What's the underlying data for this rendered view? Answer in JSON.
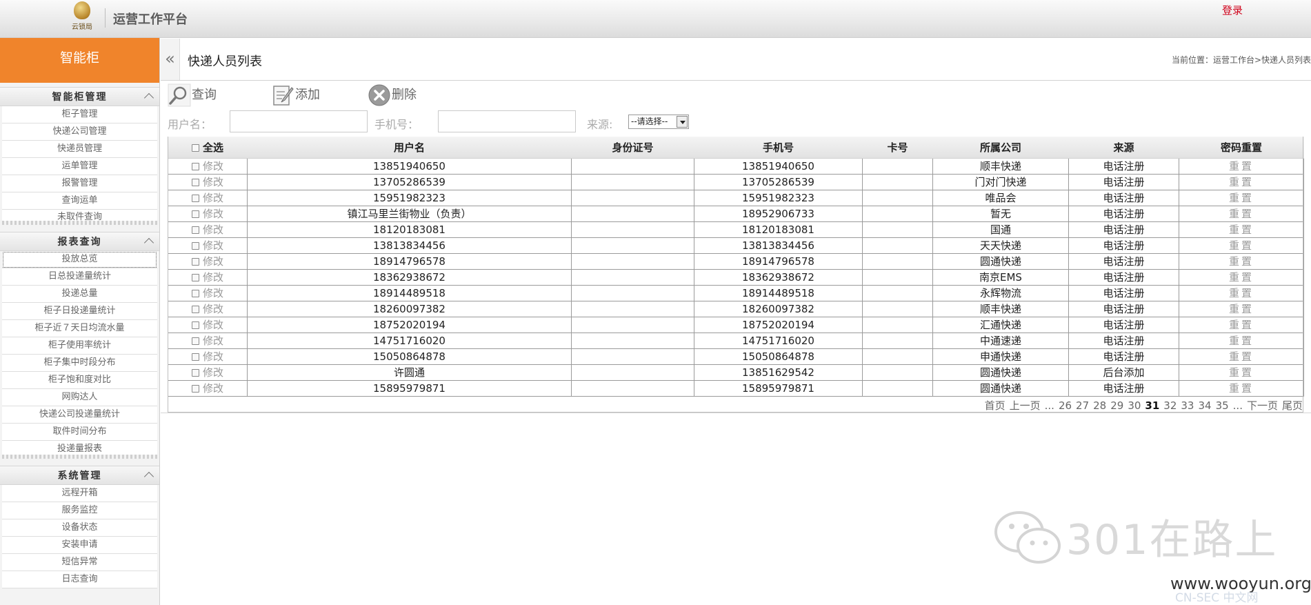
{
  "header": {
    "logo_text": "云锁局",
    "title": "运营工作平台",
    "login": "登录"
  },
  "sidebar": {
    "brand": "智能柜",
    "groups": [
      {
        "title": "智能柜管理",
        "items": [
          "柜子管理",
          "快递公司管理",
          "快递员管理",
          "运单管理",
          "报警管理",
          "查询运单",
          "未取件查询"
        ]
      },
      {
        "title": "报表查询",
        "items": [
          "投放总览",
          "日总投递量统计",
          "投递总量",
          "柜子日投递量统计",
          "柜子近７天日均流水量",
          "柜子使用率统计",
          "柜子集中时段分布",
          "柜子饱和度对比",
          "网购达人",
          "快递公司投递量统计",
          "取件时间分布",
          "投递量报表"
        ]
      },
      {
        "title": "系统管理",
        "items": [
          "远程开箱",
          "服务监控",
          "设备状态",
          "安装申请",
          "短信异常",
          "日志查询"
        ]
      }
    ]
  },
  "main": {
    "title": "快递人员列表",
    "breadcrumb": "当前位置：运营工作台>快递人员列表",
    "toolbar": {
      "query": "查询",
      "add": "添加",
      "delete": "删除"
    },
    "search": {
      "username_label": "用户名：",
      "phone_label": "手机号：",
      "source_label": "来源:",
      "source_selected": "--请选择--"
    },
    "columns": {
      "select_all": "全选",
      "username": "用户名",
      "id_no": "身份证号",
      "phone": "手机号",
      "card": "卡号",
      "company": "所属公司",
      "source": "来源",
      "reset": "密码重置"
    },
    "edit_label": "修改",
    "reset_label": "重置",
    "rows": [
      {
        "username": "13851940650",
        "id_no": "",
        "phone": "13851940650",
        "card": "",
        "company": "顺丰快递",
        "source": "电话注册"
      },
      {
        "username": "13705286539",
        "id_no": "",
        "phone": "13705286539",
        "card": "",
        "company": "门对门快递",
        "source": "电话注册"
      },
      {
        "username": "15951982323",
        "id_no": "",
        "phone": "15951982323",
        "card": "",
        "company": "唯品会",
        "source": "电话注册"
      },
      {
        "username": "镇江马里兰街物业（负责）",
        "id_no": "",
        "phone": "18952906733",
        "card": "",
        "company": "暂无",
        "source": "电话注册"
      },
      {
        "username": "18120183081",
        "id_no": "",
        "phone": "18120183081",
        "card": "",
        "company": "国通",
        "source": "电话注册"
      },
      {
        "username": "13813834456",
        "id_no": "",
        "phone": "13813834456",
        "card": "",
        "company": "天天快递",
        "source": "电话注册"
      },
      {
        "username": "18914796578",
        "id_no": "",
        "phone": "18914796578",
        "card": "",
        "company": "圆通快递",
        "source": "电话注册"
      },
      {
        "username": "18362938672",
        "id_no": "",
        "phone": "18362938672",
        "card": "",
        "company": "南京EMS",
        "source": "电话注册"
      },
      {
        "username": "18914489518",
        "id_no": "",
        "phone": "18914489518",
        "card": "",
        "company": "永辉物流",
        "source": "电话注册"
      },
      {
        "username": "18260097382",
        "id_no": "",
        "phone": "18260097382",
        "card": "",
        "company": "顺丰快递",
        "source": "电话注册"
      },
      {
        "username": "18752020194",
        "id_no": "",
        "phone": "18752020194",
        "card": "",
        "company": "汇通快递",
        "source": "电话注册"
      },
      {
        "username": "14751716020",
        "id_no": "",
        "phone": "14751716020",
        "card": "",
        "company": "中通速递",
        "source": "电话注册"
      },
      {
        "username": "15050864878",
        "id_no": "",
        "phone": "15050864878",
        "card": "",
        "company": "申通快递",
        "source": "电话注册"
      },
      {
        "username": "许圆通",
        "id_no": "",
        "phone": "13851629542",
        "card": "",
        "company": "圆通快递",
        "source": "后台添加"
      },
      {
        "username": "15895979871",
        "id_no": "",
        "phone": "15895979871",
        "card": "",
        "company": "圆通快递",
        "source": "电话注册"
      }
    ],
    "pager": {
      "first": "首页",
      "prev": "上一页",
      "ellipsis_left": "...",
      "pages": [
        "26",
        "27",
        "28",
        "29",
        "30",
        "31",
        "32",
        "33",
        "34",
        "35"
      ],
      "current": "31",
      "ellipsis_right": "...",
      "next": "下一页",
      "last": "尾页"
    }
  },
  "watermark": {
    "brand": "301在路上",
    "site": "www.wooyun.org",
    "cn": "CN-SEC 中文网"
  }
}
